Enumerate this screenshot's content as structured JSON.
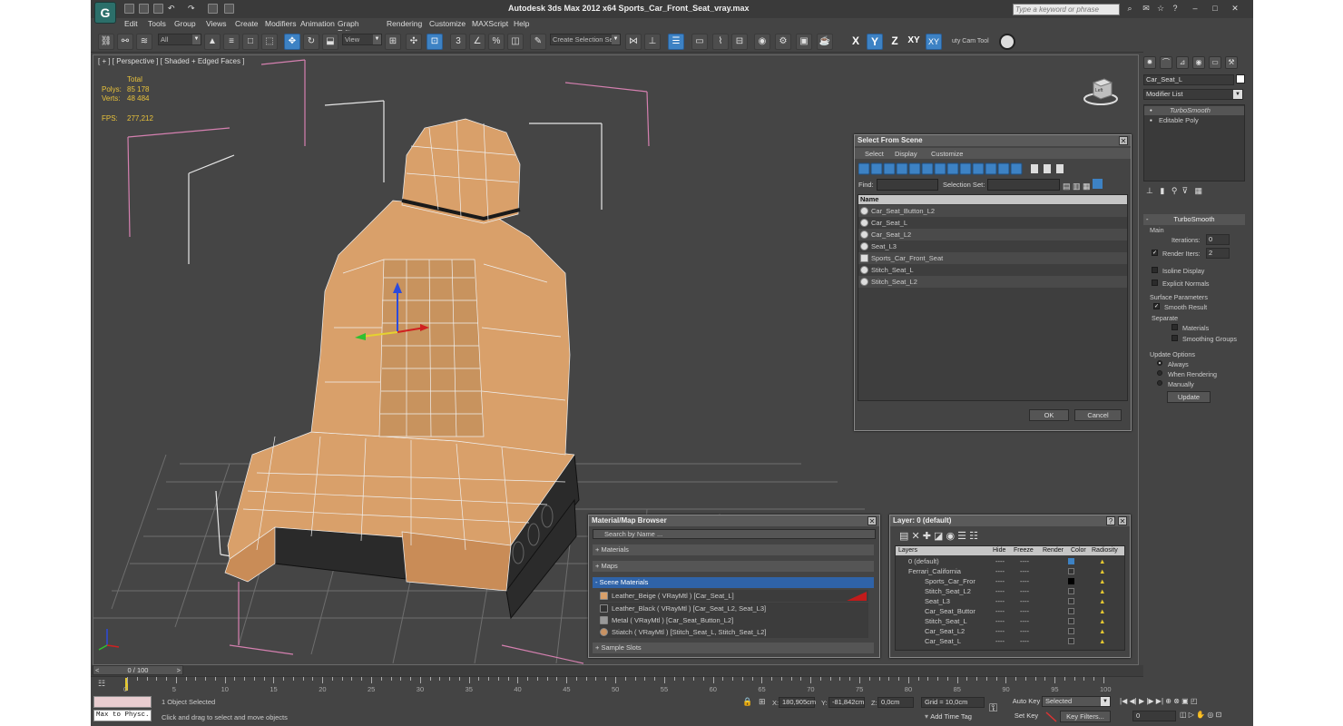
{
  "window": {
    "title": "Autodesk 3ds Max  2012 x64      Sports_Car_Front_Seat_vray.max",
    "search_placeholder": "Type a keyword or phrase",
    "app_logo": "G"
  },
  "menu": [
    "Edit",
    "Tools",
    "Group",
    "Views",
    "Create",
    "Modifiers",
    "Animation",
    "Graph Editors",
    "Rendering",
    "Customize",
    "MAXScript",
    "Help"
  ],
  "toolbar": {
    "filter_dropdown": "All",
    "refcoord_dropdown": "View",
    "selection_set_dropdown": "Create Selection Se",
    "axis_x": "X",
    "axis_y": "Y",
    "axis_z": "Z",
    "axis_xy": "XY",
    "axis_xy2": "XY",
    "cam_tool": "uty Cam Tool"
  },
  "viewport": {
    "label": "[ + ] [ Perspective ] [ Shaded + Edged Faces ]",
    "stats": {
      "total_label": "Total",
      "polys_label": "Polys:",
      "polys_value": "85 178",
      "verts_label": "Verts:",
      "verts_value": "48 484",
      "fps_label": "FPS:",
      "fps_value": "277,212"
    },
    "viewcube_label": "Left"
  },
  "select_from_scene": {
    "title": "Select From Scene",
    "menus": [
      "Select",
      "Display",
      "Customize"
    ],
    "find_label": "Find:",
    "selection_set_label": "Selection Set:",
    "column_name": "Name",
    "items": [
      "Car_Seat_Button_L2",
      "Car_Seat_L",
      "Car_Seat_L2",
      "Seat_L3",
      "Sports_Car_Front_Seat",
      "Stitch_Seat_L",
      "Stitch_Seat_L2"
    ],
    "ok_label": "OK",
    "cancel_label": "Cancel"
  },
  "material_browser": {
    "title": "Material/Map Browser",
    "search_placeholder": "Search by Name ...",
    "sections": {
      "materials": "+ Materials",
      "maps": "+ Maps",
      "scene": "- Scene Materials",
      "sample": "+ Sample Slots"
    },
    "scene_materials": [
      "Leather_Beige  ( VRayMtl )  [Car_Seat_L]",
      "Leather_Black  ( VRayMtl )  [Car_Seat_L2, Seat_L3]",
      "Metal  ( VRayMtl )  [Car_Seat_Button_L2]",
      "Stiatch  ( VRayMtl )  [Stitch_Seat_L, Stitch_Seat_L2]"
    ]
  },
  "layer_dialog": {
    "title": "Layer: 0 (default)",
    "help": "?",
    "columns": [
      "Layers",
      "Hide",
      "Freeze",
      "Render",
      "Color",
      "Radiosity"
    ],
    "layers": [
      {
        "name": "0 (default)"
      },
      {
        "name": "Ferrari_California"
      },
      {
        "name": "Sports_Car_Fror"
      },
      {
        "name": "Stitch_Seat_L2"
      },
      {
        "name": "Seat_L3"
      },
      {
        "name": "Car_Seat_Buttor"
      },
      {
        "name": "Stitch_Seat_L"
      },
      {
        "name": "Car_Seat_L2"
      },
      {
        "name": "Car_Seat_L"
      }
    ],
    "dash": "----"
  },
  "command_panel": {
    "object_name": "Car_Seat_L",
    "modifier_list": "Modifier List",
    "stack": [
      "TurboSmooth",
      "Editable Poly"
    ],
    "rollout_title": "TurboSmooth",
    "main_label": "Main",
    "iterations_label": "Iterations:",
    "iterations_value": "0",
    "render_iters_label": "Render Iters:",
    "render_iters_value": "2",
    "isoline_label": "Isoline Display",
    "explicit_normals_label": "Explicit Normals",
    "surface_params_label": "Surface Parameters",
    "smooth_result_label": "Smooth Result",
    "separate_label": "Separate",
    "materials_label": "Materials",
    "smoothing_groups_label": "Smoothing Groups",
    "update_options_label": "Update Options",
    "always_label": "Always",
    "when_rendering_label": "When Rendering",
    "manually_label": "Manually",
    "update_button": "Update"
  },
  "timeline": {
    "frame_label": "0 / 100",
    "ticks": [
      "0",
      "5",
      "10",
      "15",
      "20",
      "25",
      "30",
      "35",
      "40",
      "45",
      "50",
      "55",
      "60",
      "65",
      "70",
      "75",
      "80",
      "85",
      "90",
      "95",
      "100"
    ]
  },
  "status": {
    "maxscript": "Max to Physc.",
    "selected": "1 Object Selected",
    "prompt": "Click and drag to select and move objects",
    "x_label": "X:",
    "x_value": "180,905cm",
    "y_label": "Y:",
    "y_value": "-81,842cm",
    "z_label": "Z:",
    "z_value": "0,0cm",
    "grid": "Grid = 10,0cm",
    "add_time_tag": "Add Time Tag",
    "auto_key": "Auto Key",
    "set_key": "Set Key",
    "selected_dropdown": "Selected",
    "key_filters": "Key Filters...",
    "frame_value": "0"
  }
}
